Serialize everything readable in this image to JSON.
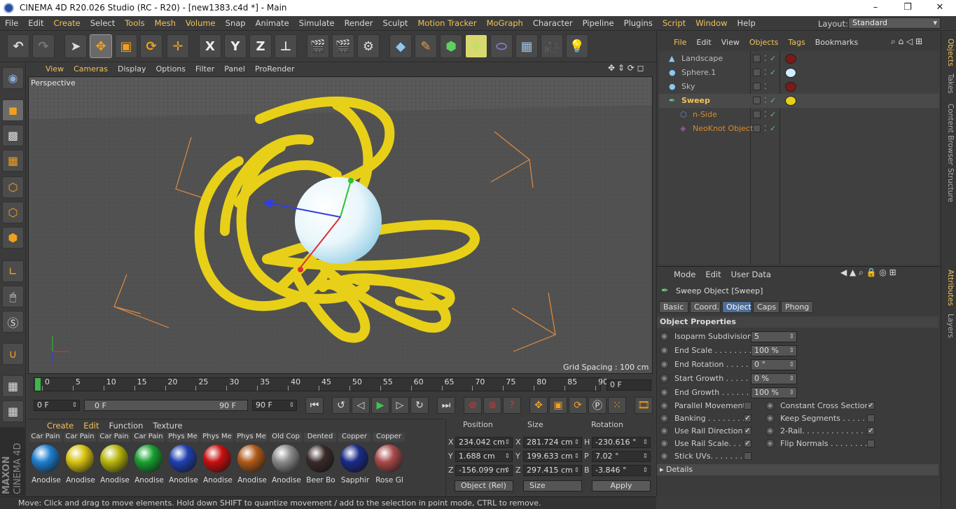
{
  "window": {
    "title": "CINEMA 4D R20.026 Studio (RC - R20) - [new1383.c4d *] - Main",
    "minimize": "–",
    "maximize": "❐",
    "close": "✕"
  },
  "menu": [
    "File",
    "Edit",
    "Create",
    "Select",
    "Tools",
    "Mesh",
    "Volume",
    "Snap",
    "Animate",
    "Simulate",
    "Render",
    "Sculpt",
    "Motion Tracker",
    "MoGraph",
    "Character",
    "Pipeline",
    "Plugins",
    "Script",
    "Window",
    "Help"
  ],
  "menu_highlight": [
    "Create",
    "Tools",
    "Mesh",
    "Volume",
    "Motion Tracker",
    "MoGraph",
    "Script",
    "Window"
  ],
  "layout": {
    "label": "Layout:",
    "value": "Standard"
  },
  "toolbar": {
    "x": "X",
    "y": "Y",
    "z": "Z"
  },
  "viewport": {
    "menu": [
      "View",
      "Cameras",
      "Display",
      "Options",
      "Filter",
      "Panel",
      "ProRender"
    ],
    "menu_highlight": [
      "View",
      "Cameras"
    ],
    "name": "Perspective",
    "grid_spacing": "Grid Spacing : 100 cm"
  },
  "timeline": {
    "ticks": [
      "0",
      "5",
      "10",
      "15",
      "20",
      "25",
      "30",
      "35",
      "40",
      "45",
      "50",
      "55",
      "60",
      "65",
      "70",
      "75",
      "80",
      "85",
      "90"
    ],
    "current_frame": "0 F"
  },
  "transport": {
    "start": "0 F",
    "range_start": "0 F",
    "range_end": "90 F",
    "end": "90 F"
  },
  "materials": {
    "menu": [
      "Create",
      "Edit",
      "Function",
      "Texture"
    ],
    "menu_highlight": [
      "Create",
      "Edit"
    ],
    "items": [
      {
        "top": "Car Pain",
        "name": "Anodise",
        "color": "#1e7fd0"
      },
      {
        "top": "Car Pain",
        "name": "Anodise",
        "color": "#d8c210"
      },
      {
        "top": "Car Pain",
        "name": "Anodise",
        "color": "#b7b60a"
      },
      {
        "top": "Car Pain",
        "name": "Anodise",
        "color": "#18a030"
      },
      {
        "top": "Phys Me",
        "name": "Anodise",
        "color": "#1f3fb0"
      },
      {
        "top": "Phys Me",
        "name": "Anodise",
        "color": "#c81010"
      },
      {
        "top": "Phys Me",
        "name": "Anodise",
        "color": "#b05a1a"
      },
      {
        "top": "Old Cop",
        "name": "Anodise",
        "color": "#8a8a8a"
      },
      {
        "top": "Dented",
        "name": "Beer Bo",
        "color": "#3a2a2a"
      },
      {
        "top": "Copper",
        "name": "Sapphir",
        "color": "#1a2a88"
      },
      {
        "top": "Copper",
        "name": "Rose Gl",
        "color": "#a84a4a"
      }
    ]
  },
  "brand": {
    "maxon": "MAXON",
    "product": "CINEMA 4D"
  },
  "coords": {
    "headers": [
      "Position",
      "Size",
      "Rotation"
    ],
    "rows": [
      {
        "axis": "X",
        "pos": "234.042 cm",
        "saxis": "X",
        "size": "281.724 cm",
        "raxis": "H",
        "rot": "-230.616 °"
      },
      {
        "axis": "Y",
        "pos": "1.688 cm",
        "saxis": "Y",
        "size": "199.633 cm",
        "raxis": "P",
        "rot": "7.02 °"
      },
      {
        "axis": "Z",
        "pos": "-156.099 cm",
        "saxis": "Z",
        "size": "297.415 cm",
        "raxis": "B",
        "rot": "-3.846 °"
      }
    ],
    "mode": "Object (Rel)",
    "size_mode": "Size",
    "apply": "Apply"
  },
  "status": "Move: Click and drag to move elements. Hold down SHIFT to quantize movement / add to the selection in point mode, CTRL to remove.",
  "objects": {
    "menu": [
      "File",
      "Edit",
      "View",
      "Objects",
      "Tags",
      "Bookmarks"
    ],
    "menu_highlight": [
      "File",
      "Objects",
      "Tags"
    ],
    "items": [
      {
        "name": "Landscape",
        "color": "#bbbbbb",
        "icon": "landscape-icon"
      },
      {
        "name": "Sphere.1",
        "color": "#bbbbbb",
        "icon": "sphere-icon"
      },
      {
        "name": "Sky",
        "color": "#bbbbbb",
        "icon": "sky-icon"
      },
      {
        "name": "Sweep",
        "color": "#f2c25a",
        "icon": "sweep-icon"
      },
      {
        "name": "n-Side",
        "color": "#d98a2a",
        "icon": "nside-icon"
      },
      {
        "name": "NeoKnot Object",
        "color": "#d98a2a",
        "icon": "neoknot-icon"
      }
    ]
  },
  "attributes": {
    "menu": [
      "Mode",
      "Edit",
      "User Data"
    ],
    "object_title": "Sweep Object [Sweep]",
    "tabs": [
      "Basic",
      "Coord.",
      "Object",
      "Caps",
      "Phong"
    ],
    "active_tab": "Object",
    "section": "Object Properties",
    "fields": [
      {
        "label": "Isoparm Subdivision",
        "value": "5"
      },
      {
        "label": "End Scale . . . . . . . . .",
        "value": "100 %"
      },
      {
        "label": "End Rotation . . . . . .",
        "value": "0 °"
      },
      {
        "label": "Start Growth . . . . . .",
        "value": "0 %"
      },
      {
        "label": "End Growth . . . . . . .",
        "value": "100 %"
      }
    ],
    "checks_left": [
      {
        "label": "Parallel Movement",
        "checked": false
      },
      {
        "label": "Banking . . . . . . . . .",
        "checked": true
      },
      {
        "label": "Use Rail Direction",
        "checked": true
      },
      {
        "label": "Use Rail Scale. . . .",
        "checked": true
      },
      {
        "label": "Stick UVs. . . . . . . .",
        "checked": false
      }
    ],
    "checks_right": [
      {
        "label": "Constant Cross Section",
        "checked": true
      },
      {
        "label": "Keep Segments . . . . . .",
        "checked": false
      },
      {
        "label": "2-Rail. . . . . . . . . . . . .",
        "checked": true
      },
      {
        "label": "Flip Normals . . . . . . . .",
        "checked": false
      }
    ],
    "details": "Details"
  },
  "sidetabs": [
    "Objects",
    "Takes",
    "Content Browser",
    "Structure",
    "Attributes",
    "Layers"
  ]
}
